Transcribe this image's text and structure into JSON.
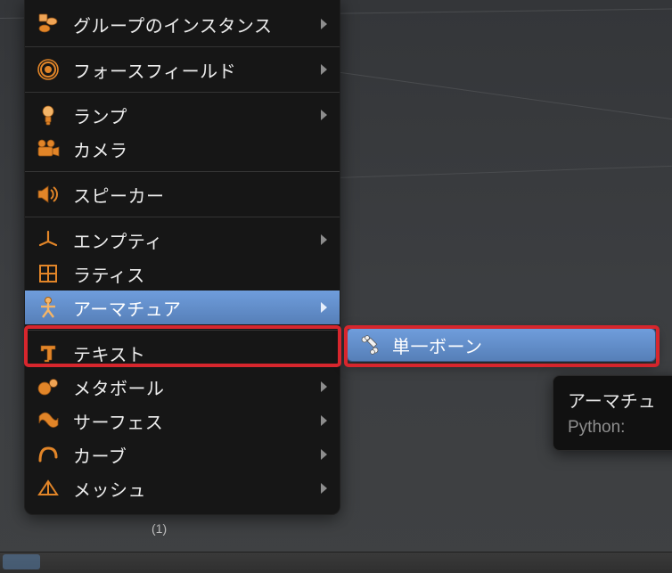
{
  "menu": {
    "group_instance": "グループのインスタンス",
    "force_field": "フォースフィールド",
    "lamp": "ランプ",
    "camera": "カメラ",
    "speaker": "スピーカー",
    "empty": "エンプティ",
    "lattice": "ラティス",
    "armature": "アーマチュア",
    "text": "テキスト",
    "metaball": "メタボール",
    "surface": "サーフェス",
    "curve": "カーブ",
    "mesh": "メッシュ"
  },
  "submenu": {
    "single_bone": "単一ボーン"
  },
  "tooltip": {
    "title": "アーマチュ",
    "python_prefix": "Python:"
  },
  "viewport": {
    "overlay_text": "(1)"
  },
  "colors": {
    "accent_orange": "#e28528",
    "highlight_blue": "#5e8bc8",
    "danger_red": "#d7262d"
  }
}
